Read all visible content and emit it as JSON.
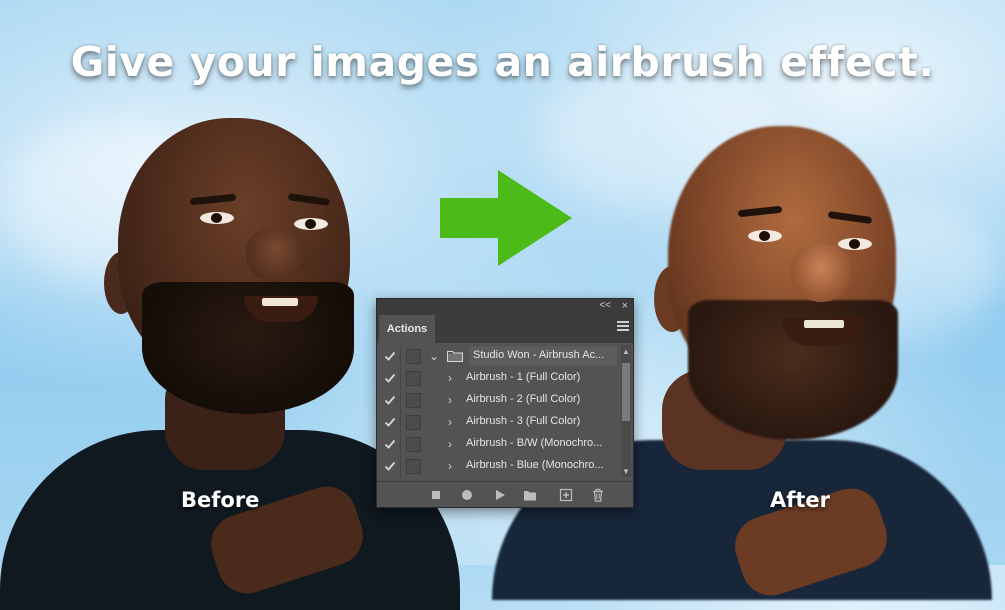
{
  "headline": "Give your images an airbrush effect.",
  "labels": {
    "before": "Before",
    "after": "After"
  },
  "colors": {
    "arrow": "#4cbb17",
    "panel_bg": "#535353",
    "panel_header": "#3c3c3c"
  },
  "panel": {
    "tab_label": "Actions",
    "collapse_glyph": "<<",
    "close_glyph": "×",
    "rows": [
      {
        "checked": true,
        "expanded": true,
        "type": "set",
        "name": "Studio Won - Airbrush  Ac..."
      },
      {
        "checked": true,
        "expanded": false,
        "type": "action",
        "name": "Airbrush - 1 (Full Color)"
      },
      {
        "checked": true,
        "expanded": false,
        "type": "action",
        "name": "Airbrush - 2 (Full Color)"
      },
      {
        "checked": true,
        "expanded": false,
        "type": "action",
        "name": "Airbrush - 3 (Full Color)"
      },
      {
        "checked": true,
        "expanded": false,
        "type": "action",
        "name": "Airbrush - B/W (Monochro..."
      },
      {
        "checked": true,
        "expanded": false,
        "type": "action",
        "name": "Airbrush - Blue (Monochro..."
      }
    ],
    "footer_icons": [
      "stop-icon",
      "record-icon",
      "play-icon",
      "new-set-icon",
      "new-action-icon",
      "delete-icon"
    ]
  }
}
